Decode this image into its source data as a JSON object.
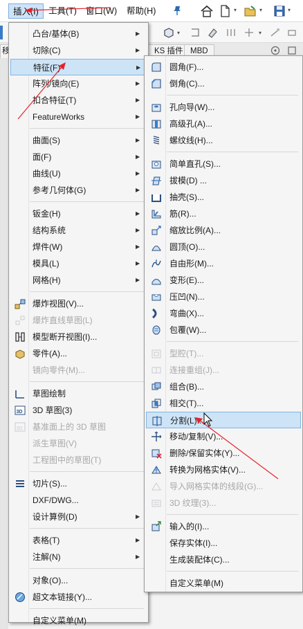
{
  "menubar": {
    "insert": "插入(I)",
    "tools": "工具(T)",
    "window": "窗口(W)",
    "help": "帮助(H)"
  },
  "tabs": {
    "tab_left": "移",
    "tab_ks": "KS 插件",
    "tab_mbd": "MBD"
  },
  "insert_menu": [
    {
      "label": "凸台/基体(B)",
      "submenu": true
    },
    {
      "label": "切除(C)",
      "submenu": true
    },
    {
      "label": "特征(F)",
      "submenu": true,
      "hover": true
    },
    {
      "label": "阵列/镜向(E)",
      "submenu": true
    },
    {
      "label": "扣合特征(T)",
      "submenu": true
    },
    {
      "label": "FeatureWorks",
      "submenu": true
    },
    {
      "label": "曲面(S)",
      "submenu": true
    },
    {
      "label": "面(F)",
      "submenu": true
    },
    {
      "label": "曲线(U)",
      "submenu": true
    },
    {
      "label": "参考几何体(G)",
      "submenu": true
    },
    {
      "label": "钣金(H)",
      "submenu": true
    },
    {
      "label": "结构系统",
      "submenu": true
    },
    {
      "label": "焊件(W)",
      "submenu": true
    },
    {
      "label": "模具(L)",
      "submenu": true
    },
    {
      "label": "网格(H)",
      "submenu": true
    },
    {
      "label": "爆炸视图(V)...",
      "icon": "exploded-view-icon"
    },
    {
      "label": "爆炸直线草图(L)",
      "icon": "explode-line-icon",
      "disabled": true
    },
    {
      "label": "模型断开视图(I)...",
      "icon": "break-view-icon"
    },
    {
      "label": "零件(A)...",
      "icon": "part-icon"
    },
    {
      "label": "镜向零件(M)...",
      "disabled": true
    },
    {
      "label": "草图绘制",
      "icon": "sketch-icon"
    },
    {
      "label": "3D 草图(3)",
      "icon": "3d-sketch-icon"
    },
    {
      "label": "基准面上的 3D 草图",
      "icon": "3d-sketch-plane-icon",
      "disabled": true
    },
    {
      "label": "派生草图(V)",
      "disabled": true
    },
    {
      "label": "工程图中的草图(T)",
      "disabled": true
    },
    {
      "label": "切片(S)...",
      "icon": "slice-icon"
    },
    {
      "label": "DXF/DWG..."
    },
    {
      "label": "设计算例(D)",
      "submenu": true
    },
    {
      "label": "表格(T)",
      "submenu": true
    },
    {
      "label": "注解(N)",
      "submenu": true
    },
    {
      "label": "对象(O)..."
    },
    {
      "label": "超文本链接(Y)...",
      "icon": "hyperlink-icon"
    },
    {
      "label": "自定义菜单(M)"
    }
  ],
  "feature_menu": [
    {
      "label": "圆角(F)...",
      "icon": "fillet-icon"
    },
    {
      "label": "倒角(C)...",
      "icon": "chamfer-icon"
    },
    {
      "label": "孔向导(W)...",
      "icon": "hole-wizard-icon"
    },
    {
      "label": "高级孔(A)...",
      "icon": "advanced-hole-icon"
    },
    {
      "label": "螺纹线(H)...",
      "icon": "thread-icon"
    },
    {
      "label": "简单直孔(S)...",
      "icon": "simple-hole-icon"
    },
    {
      "label": "拔模(D) ...",
      "icon": "draft-icon"
    },
    {
      "label": "抽壳(S)...",
      "icon": "shell-icon"
    },
    {
      "label": "筋(R)...",
      "icon": "rib-icon"
    },
    {
      "label": "缩放比例(A)...",
      "icon": "scale-icon"
    },
    {
      "label": "圆顶(O)...",
      "icon": "dome-icon"
    },
    {
      "label": "自由形(M)...",
      "icon": "freeform-icon"
    },
    {
      "label": "变形(E)...",
      "icon": "deform-icon"
    },
    {
      "label": "压凹(N)...",
      "icon": "indent-icon"
    },
    {
      "label": "弯曲(X)...",
      "icon": "flex-icon"
    },
    {
      "label": "包覆(W)...",
      "icon": "wrap-icon"
    },
    {
      "label": "型腔(T)...",
      "icon": "cavity-icon",
      "disabled": true
    },
    {
      "label": "连接重组(J)...",
      "icon": "join-icon",
      "disabled": true
    },
    {
      "label": "组合(B)...",
      "icon": "combine-icon"
    },
    {
      "label": "相交(T)...",
      "icon": "intersect-icon"
    },
    {
      "label": "分割(L)...",
      "icon": "split-icon",
      "highlight": true
    },
    {
      "label": "移动/复制(V)...",
      "icon": "move-copy-icon"
    },
    {
      "label": "删除/保留实体(Y)...",
      "icon": "delete-body-icon"
    },
    {
      "label": "转换为网格实体(V)...",
      "icon": "convert-mesh-icon"
    },
    {
      "label": "导入网格实体的线段(G)...",
      "icon": "mesh-segment-icon",
      "disabled": true
    },
    {
      "label": "3D 纹理(3)...",
      "icon": "3d-texture-icon",
      "disabled": true
    },
    {
      "label": "输入的(I)...",
      "icon": "imported-icon"
    },
    {
      "label": "保存实体(I)..."
    },
    {
      "label": "生成装配体(C)..."
    },
    {
      "label": "自定义菜单(M)"
    }
  ],
  "colors": {
    "hover_bg": "#cde4f7",
    "hover_border": "#7fb3e4",
    "annotation_red": "#e8202a",
    "icon_blue": "#3a7bc8"
  }
}
